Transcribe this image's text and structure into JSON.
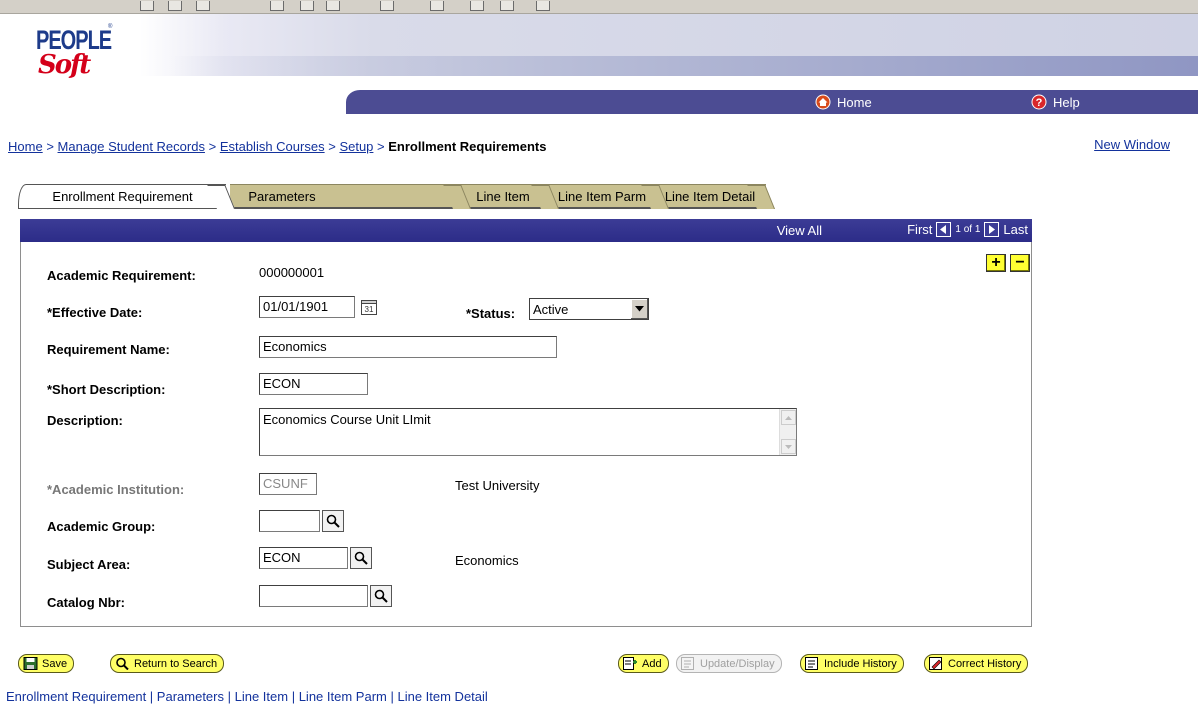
{
  "banner": {
    "logo_text_top": "PEOPLE",
    "logo_text_bottom": "Soft",
    "nav": {
      "home": "Home",
      "help": "Help"
    }
  },
  "breadcrumb": {
    "items": [
      "Home",
      "Manage Student Records",
      "Establish Courses",
      "Setup"
    ],
    "separator": ">",
    "current": "Enrollment Requirements"
  },
  "new_window": "New Window",
  "tabs": [
    {
      "label": "Enrollment Requirement",
      "active": true
    },
    {
      "label": "Parameters",
      "active": false
    },
    {
      "label": "Line Item",
      "active": false
    },
    {
      "label": "Line Item Parm",
      "active": false
    },
    {
      "label": "Line Item Detail",
      "active": false
    }
  ],
  "panel_header": {
    "view_all": "View All",
    "first": "First",
    "page_of": "1 of 1",
    "last": "Last"
  },
  "form": {
    "academic_requirement": {
      "label": "Academic Requirement:",
      "value": "000000001"
    },
    "effective_date": {
      "label": "*Effective Date:",
      "value": "01/01/1901"
    },
    "status": {
      "label": "*Status:",
      "value": "Active"
    },
    "requirement_name": {
      "label": "Requirement Name:",
      "value": "Economics"
    },
    "short_description": {
      "label": "*Short Description:",
      "value": "ECON"
    },
    "description": {
      "label": "Description:",
      "value": "Economics Course Unit LImit"
    },
    "academic_institution": {
      "label": "*Academic Institution:",
      "value": "CSUNF",
      "description": "Test University"
    },
    "academic_group": {
      "label": "Academic Group:",
      "value": ""
    },
    "subject_area": {
      "label": "Subject Area:",
      "value": "ECON",
      "description": "Economics"
    },
    "catalog_nbr": {
      "label": "Catalog Nbr:",
      "value": ""
    }
  },
  "buttons": {
    "save": "Save",
    "return_to_search": "Return to Search",
    "add": "Add",
    "update_display": "Update/Display",
    "include_history": "Include History",
    "correct_history": "Correct History"
  },
  "bottom_links": [
    "Enrollment Requirement",
    "Parameters",
    "Line Item",
    "Line Item Parm",
    "Line Item Detail"
  ],
  "colors": {
    "nav_bar": "#4c4c93",
    "panel_header": "#2f2f8c",
    "tab_inactive": "#c9c191",
    "button_yellow": "#ffff66",
    "link": "#13329c"
  }
}
